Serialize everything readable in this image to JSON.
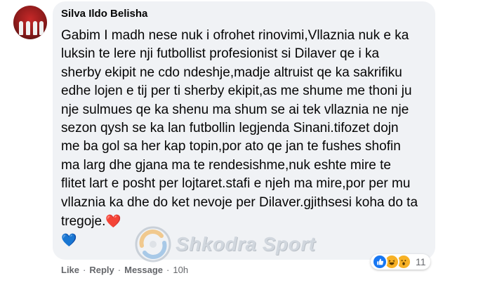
{
  "comment": {
    "author": "Silva Ildo Belisha",
    "text": "Gabim I madh nese nuk i ofrohet rinovimi,Vllaznia nuk e ka luksin te lere nji futbollist profesionist si Dilaver qe i ka sherby ekipit ne cdo ndeshje,madje altruist qe ka sakrifiku edhe lojen e tij per ti sherby ekipit,as me shume me thoni ju nje sulmues qe ka shenu ma shum se ai tek vllaznia ne nje sezon qysh se ka lan futbollin legjenda Sinani.tifozet dojn me ba gol sa her kap topin,por ato qe jan te fushes shofin ma larg dhe gjana ma te rendesishme,nuk eshte mire te flitet lart e posht per lojtaret.stafi e njeh ma mire,por per mu vllaznia ka dhe do ket nevoje per Dilaver.gjithsesi koha do ta tregoje.",
    "emoji_end": "❤️",
    "emoji_newline": "💙"
  },
  "actions": {
    "like": "Like",
    "reply": "Reply",
    "message": "Message",
    "time": "10h",
    "separator": "·"
  },
  "reactions": {
    "icons": [
      "like-icon",
      "haha-icon",
      "wow-icon"
    ],
    "count": "11"
  },
  "watermark": {
    "text": "Shkodra Sport"
  },
  "colors": {
    "bubble": "#f0f2f5",
    "meta": "#65676b",
    "like": "#1877f2"
  }
}
